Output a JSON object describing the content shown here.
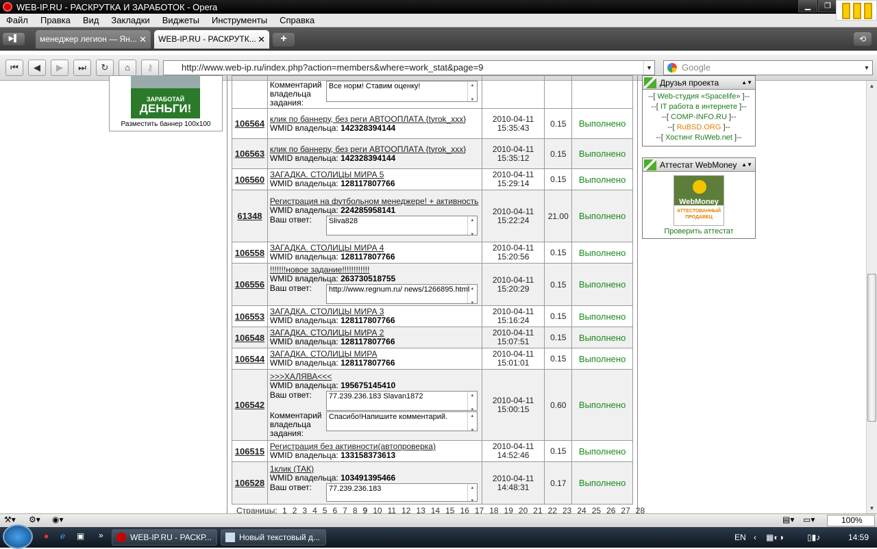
{
  "window": {
    "title": "WEB-IP.RU - РАСКРУТКА И ЗАРАБОТОК - Opera"
  },
  "menu": [
    "Файл",
    "Правка",
    "Вид",
    "Закладки",
    "Виджеты",
    "Инструменты",
    "Справка"
  ],
  "tabs": [
    {
      "label": "менеджер легион — Ян...",
      "close": "✕"
    },
    {
      "label": "WEB-IP.RU - РАСКРУТК...",
      "close": "✕"
    }
  ],
  "address": {
    "url": "http://www.web-ip.ru/index.php?action=members&where=work_stat&page=9"
  },
  "search": {
    "placeholder": "Google"
  },
  "left_banner": {
    "line1": "ЗАРАБОТАЙ",
    "line2": "ДЕНЬГИ!",
    "caption": "Разместить баннер 100x100"
  },
  "labels": {
    "wmid": "WMID владельца:",
    "answer": "Ваш ответ:",
    "comment": "Комментарий владельца задания:"
  },
  "rows": [
    {
      "id": "",
      "title": "",
      "wmid": "",
      "answer": "",
      "comment": "Все норм! Ставим оценку!",
      "date": "",
      "time": "",
      "price": "",
      "status": ""
    },
    {
      "id": "106564",
      "title": "клик по баннеру, без реги АВТООПЛАТА {tyrok_xxx}",
      "wmid": "142328394144",
      "date": "2010-04-11",
      "time": "15:35:43",
      "price": "0.15",
      "status": "Выполнено"
    },
    {
      "id": "106563",
      "title": "клик по баннеру, без реги АВТООПЛАТА {tyrok_xxx}",
      "wmid": "142328394144",
      "date": "2010-04-11",
      "time": "15:35:12",
      "price": "0.15",
      "status": "Выполнено"
    },
    {
      "id": "106560",
      "title": "ЗАГАДКА. СТОЛИЦЫ МИРА 5",
      "wmid": "128117807766",
      "date": "2010-04-11",
      "time": "15:29:14",
      "price": "0.15",
      "status": "Выполнено"
    },
    {
      "id": "61348",
      "title": "Регистрация на футбольном менеджере! + активность",
      "wmid": "224285958141",
      "answer": "Sliva828",
      "date": "2010-04-11",
      "time": "15:22:24",
      "price": "21.00",
      "status": "Выполнено"
    },
    {
      "id": "106558",
      "title": "ЗАГАДКА. СТОЛИЦЫ МИРА 4",
      "wmid": "128117807766",
      "date": "2010-04-11",
      "time": "15:20:56",
      "price": "0.15",
      "status": "Выполнено"
    },
    {
      "id": "106556",
      "title": "!!!!!!!новое задание!!!!!!!!!!!!",
      "wmid": "263730518755",
      "answer": "http://www.regnum.ru/ news/1266895.html",
      "date": "2010-04-11",
      "time": "15:20:29",
      "price": "0.15",
      "status": "Выполнено"
    },
    {
      "id": "106553",
      "title": "ЗАГАДКА. СТОЛИЦЫ МИРА 3",
      "wmid": "128117807766",
      "date": "2010-04-11",
      "time": "15:16:24",
      "price": "0.15",
      "status": "Выполнено"
    },
    {
      "id": "106548",
      "title": "ЗАГАДКА. СТОЛИЦЫ МИРА 2",
      "wmid": "128117807766",
      "date": "2010-04-11",
      "time": "15:07:51",
      "price": "0.15",
      "status": "Выполнено"
    },
    {
      "id": "106544",
      "title": "ЗАГАДКА. СТОЛИЦЫ МИРА",
      "wmid": "128117807766",
      "date": "2010-04-11",
      "time": "15:01:01",
      "price": "0.15",
      "status": "Выполнено"
    },
    {
      "id": "106542",
      "title": ">>>ХАЛЯВА<<<",
      "wmid": "195675145410",
      "answer": " 77.239.236.183 Slavan1872",
      "comment": "Спасибо!Напишите комментарий.",
      "date": "2010-04-11",
      "time": "15:00:15",
      "price": "0.60",
      "status": "Выполнено"
    },
    {
      "id": "106515",
      "title": "Регистрация без активности(автопроверка)",
      "wmid": "133158373613",
      "date": "2010-04-11",
      "time": "14:52:46",
      "price": "0.15",
      "status": "Выполнено"
    },
    {
      "id": "106528",
      "title": "1клик (ТАК)",
      "wmid": "103491395466",
      "answer": " 77.239.236.183",
      "date": "2010-04-11",
      "time": "14:48:31",
      "price": "0.17",
      "status": "Выполнено"
    }
  ],
  "pager": {
    "label": "Страницы:",
    "pages": [
      "1",
      "2",
      "3",
      "4",
      "5",
      "6",
      "7",
      "8",
      "9",
      "10",
      "11",
      "12",
      "13",
      "14",
      "15",
      "16",
      "17",
      "18",
      "19",
      "20",
      "21",
      "22",
      "23",
      "24",
      "25",
      "26",
      "27",
      "28"
    ],
    "current": "9"
  },
  "friends": {
    "title": "Друзья проекта",
    "links": [
      "Web-студия «Spacelife»",
      "IT работа в интернете",
      "COMP-INFO.RU",
      "RuBSD.ORG",
      "Хостинг RuWeb.net"
    ]
  },
  "attestat": {
    "title": "Аттестат WebMoney",
    "logo_name": "WebMoney",
    "logo_sub": "АТТЕСТОВАННЫЙ ПРОДАВЕЦ",
    "check": "Проверить аттестат"
  },
  "statusbar": {
    "zoom": "100%"
  },
  "taskbar": {
    "items": [
      "WEB-IP.RU - РАСКР...",
      "Новый текстовый д..."
    ],
    "lang": "EN",
    "clock": "14:59"
  }
}
